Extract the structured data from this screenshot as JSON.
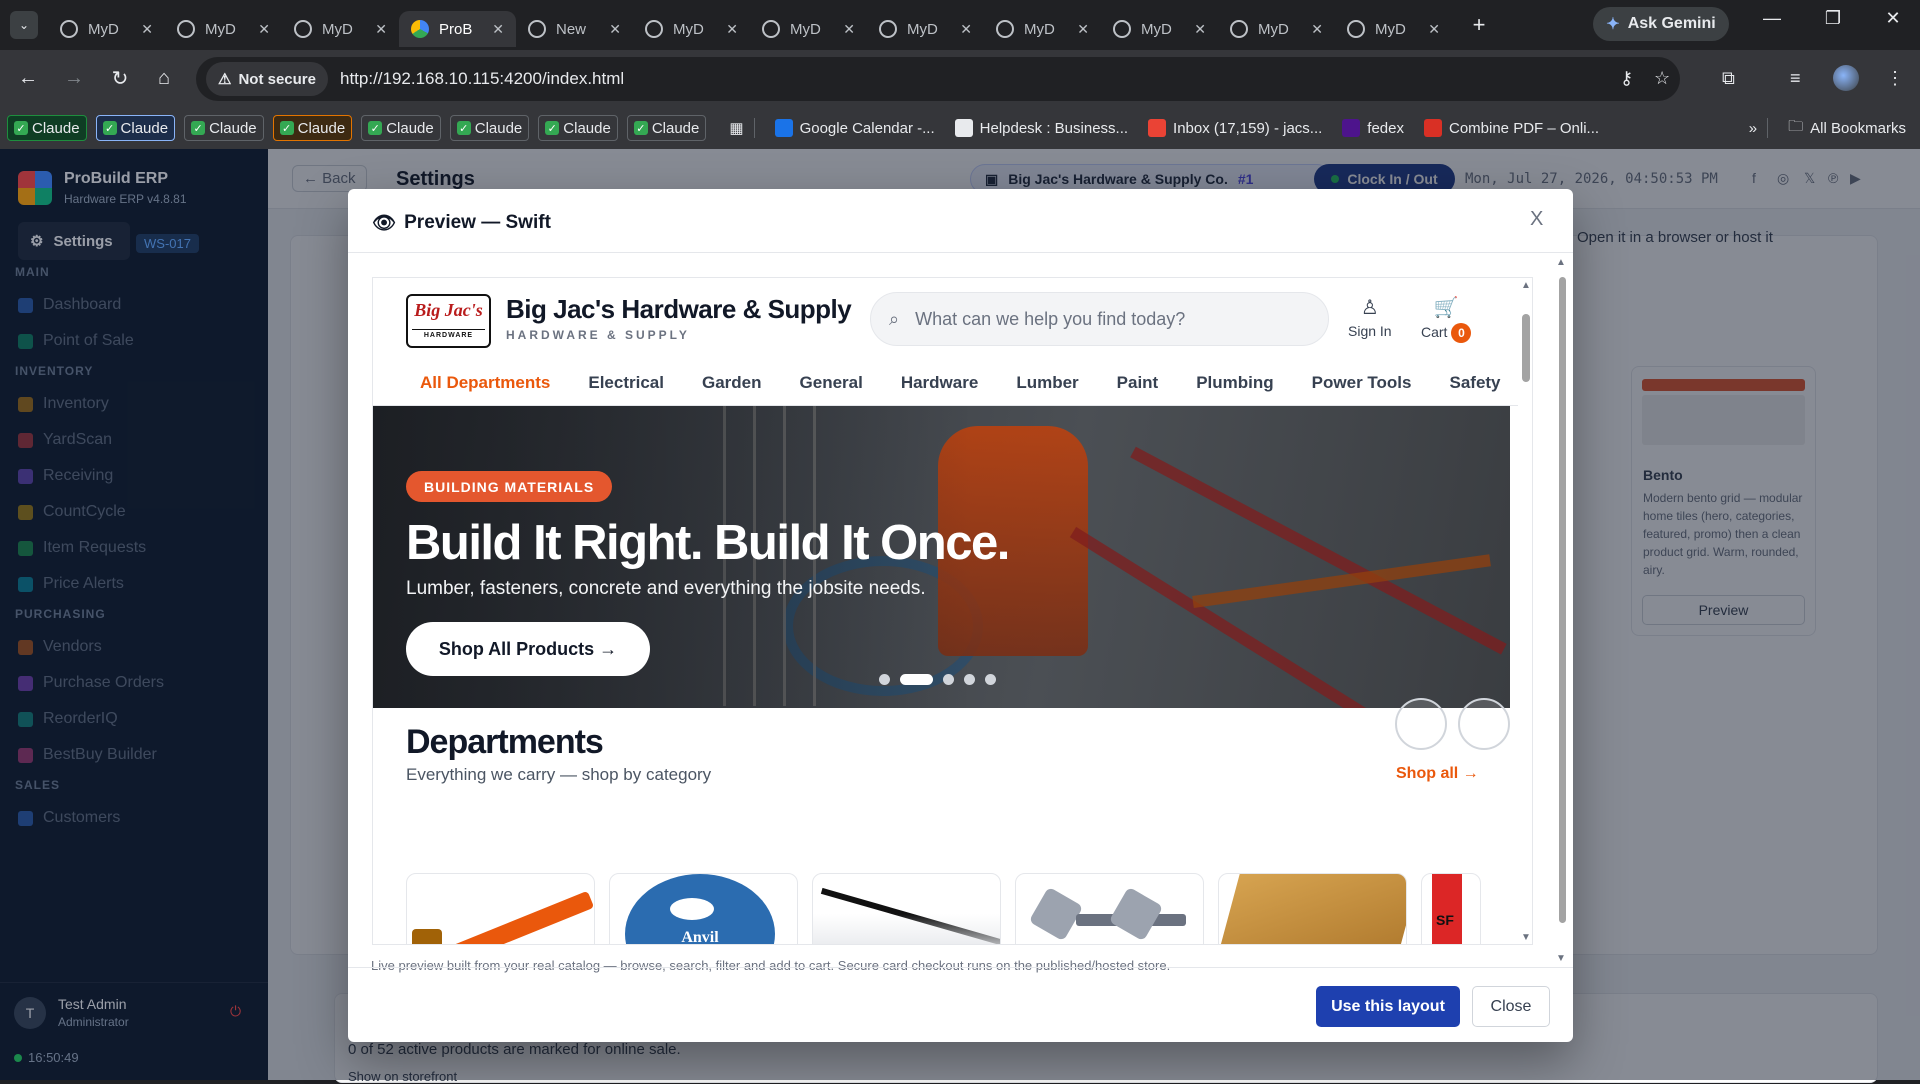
{
  "browser": {
    "tabs": [
      {
        "label": "MyD",
        "active": false
      },
      {
        "label": "MyD",
        "active": false
      },
      {
        "label": "MyD",
        "active": false
      },
      {
        "label": "ProB",
        "active": true
      },
      {
        "label": "New",
        "active": false
      },
      {
        "label": "MyD",
        "active": false
      },
      {
        "label": "MyD",
        "active": false
      },
      {
        "label": "MyD",
        "active": false
      },
      {
        "label": "MyD",
        "active": false
      },
      {
        "label": "MyD",
        "active": false
      },
      {
        "label": "MyD",
        "active": false
      },
      {
        "label": "MyD",
        "active": false
      }
    ],
    "gemini_label": "Ask Gemini",
    "security_label": "Not secure",
    "url": "http://192.168.10.115:4200/index.html",
    "bookmarks_claude": [
      "Claude",
      "Claude",
      "Claude",
      "Claude",
      "Claude",
      "Claude",
      "Claude",
      "Claude"
    ],
    "bookmarks": [
      {
        "label": "Google Calendar -...",
        "color": "#1a73e8"
      },
      {
        "label": "Helpdesk : Business...",
        "color": "#e8eaed"
      },
      {
        "label": "Inbox (17,159) - jacs...",
        "color": "#ea4335"
      },
      {
        "label": "fedex",
        "color": "#4d148c"
      },
      {
        "label": "Combine PDF – Onli...",
        "color": "#d93025"
      }
    ],
    "all_bookmarks": "All Bookmarks"
  },
  "app": {
    "brand": "ProBuild ERP",
    "version": "Hardware ERP v4.8.81",
    "settings_label": "Settings",
    "workstation": "WS-017",
    "sidebar": {
      "sections": [
        {
          "title": "MAIN",
          "items": [
            "Dashboard",
            "Point of Sale"
          ]
        },
        {
          "title": "INVENTORY",
          "items": [
            "Inventory",
            "YardScan",
            "Receiving",
            "CountCycle",
            "Item Requests",
            "Price Alerts"
          ]
        },
        {
          "title": "PURCHASING",
          "items": [
            "Vendors",
            "Purchase Orders",
            "ReorderIQ",
            "BestBuy Builder"
          ]
        },
        {
          "title": "SALES",
          "items": [
            "Customers"
          ]
        }
      ]
    },
    "user": {
      "initial": "T",
      "name": "Test Admin",
      "role": "Administrator"
    },
    "clock": "16:50:49",
    "header": {
      "back_label": "← Back",
      "title": "Settings",
      "store_name": "Big Jac's Hardware & Supply Co.",
      "store_num": "#1",
      "clock_btn": "Clock In / Out",
      "datetime": "Mon, Jul 27, 2026, 04:50:53 PM"
    },
    "background": {
      "open_note": "Open it in a browser or host it",
      "bento_title": "Bento",
      "bento_desc": "Modern bento grid — modular home tiles (hero, categories, featured, promo) then a clean product grid. Warm, rounded, airy.",
      "bento_preview": "Preview",
      "active_count": "0 of 52 active products are marked for online sale.",
      "show_storefront": "Show on storefront"
    }
  },
  "modal": {
    "title": "Preview — Swift",
    "close_x": "X",
    "note": "Live preview built from your real catalog — browse, search, filter and add to cart. Secure card checkout runs on the published/hosted store.",
    "use_btn": "Use this layout",
    "close_btn": "Close"
  },
  "site": {
    "logo_text": "Big Jac's",
    "logo_sub": "HARDWARE",
    "name": "Big Jac's Hardware & Supply",
    "tagline": "HARDWARE & SUPPLY",
    "search_placeholder": "What can we help you find today?",
    "sign_in": "Sign In",
    "cart": "Cart",
    "cart_count": "0",
    "nav": [
      "All Departments",
      "Electrical",
      "Garden",
      "General",
      "Hardware",
      "Lumber",
      "Paint",
      "Plumbing",
      "Power Tools",
      "Safety"
    ],
    "hero": {
      "pill": "BUILDING MATERIALS",
      "headline": "Build It Right. Build It Once.",
      "sub": "Lumber, fasteners, concrete and everything the jobsite needs.",
      "cta": "Shop All Products →",
      "slides": 5,
      "active_slide": 2
    },
    "departments": {
      "title": "Departments",
      "subtitle": "Everything we carry — shop by category",
      "shop_all": "Shop all →",
      "card_labels": [
        "",
        "Anvil",
        "",
        "",
        "",
        "SF"
      ]
    }
  }
}
